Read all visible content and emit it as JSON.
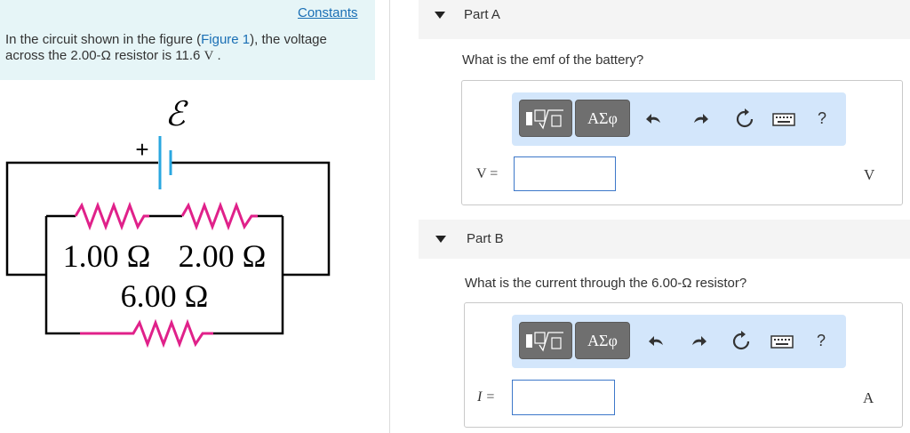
{
  "problem": {
    "constants_link": "Constants",
    "text_pre": "In the circuit shown in the figure (",
    "figure_link": "Figure 1",
    "text_mid": "), the voltage across the 2.00-",
    "omega": "Ω",
    "text_post": " resistor is 11.6 ",
    "volt_unit": "V",
    "period": " ."
  },
  "circuit": {
    "emf_symbol": "ℰ",
    "plus_sign": "+",
    "r1_label": "1.00 Ω",
    "r2_label": "2.00 Ω",
    "r3_label": "6.00 Ω",
    "resistor_color": "#e0218a",
    "battery_color": "#2aa7e0"
  },
  "part_a": {
    "title": "Part A",
    "question": "What is the emf of the battery?",
    "var_label": "V =",
    "input_value": "",
    "unit": "V"
  },
  "part_b": {
    "title": "Part B",
    "question": "What is the current through the 6.00-Ω resistor?",
    "var_label": "I =",
    "input_value": "",
    "unit": "A"
  },
  "toolbar": {
    "templates_icon": "templates-icon",
    "greek_label": "ΑΣφ",
    "undo_icon": "undo-icon",
    "redo_icon": "redo-icon",
    "reset_icon": "reset-icon",
    "keyboard_icon": "keyboard-icon",
    "help_label": "?"
  }
}
